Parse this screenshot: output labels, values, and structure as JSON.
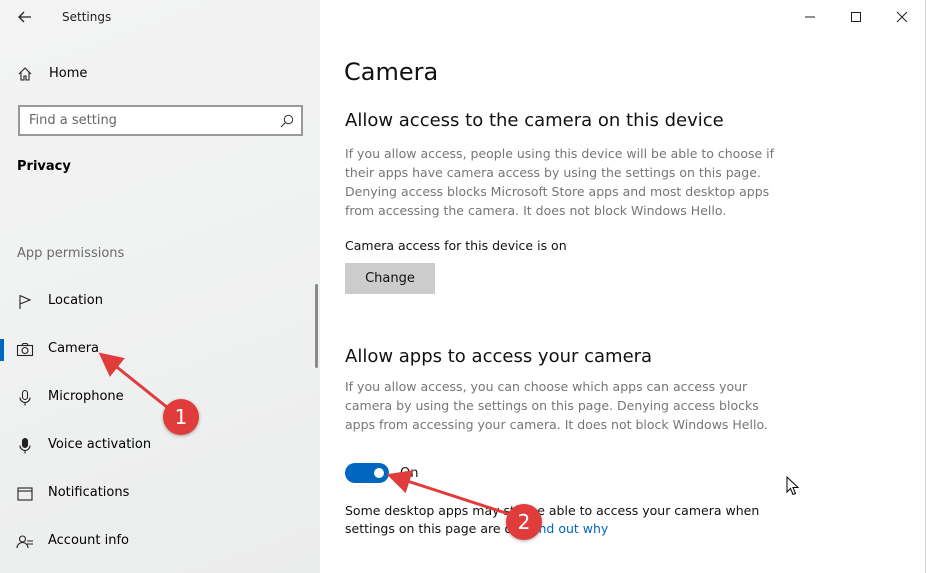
{
  "window": {
    "title": "Settings",
    "controls": {
      "minimize": "minimize-icon",
      "maximize": "maximize-icon",
      "close": "close-icon"
    }
  },
  "sidebar": {
    "home_label": "Home",
    "search_placeholder": "Find a setting",
    "section_title": "Privacy",
    "group_label": "App permissions",
    "items": [
      {
        "label": "Location",
        "icon": "location-icon",
        "selected": false
      },
      {
        "label": "Camera",
        "icon": "camera-icon",
        "selected": true
      },
      {
        "label": "Microphone",
        "icon": "microphone-icon",
        "selected": false
      },
      {
        "label": "Voice activation",
        "icon": "voice-activation-icon",
        "selected": false
      },
      {
        "label": "Notifications",
        "icon": "notifications-icon",
        "selected": false
      },
      {
        "label": "Account info",
        "icon": "account-info-icon",
        "selected": false
      }
    ]
  },
  "main": {
    "title": "Camera",
    "device_section": {
      "heading": "Allow access to the camera on this device",
      "description": "If you allow access, people using this device will be able to choose if their apps have camera access by using the settings on this page. Denying access blocks Microsoft Store apps and most desktop apps from accessing the camera. It does not block Windows Hello.",
      "status": "Camera access for this device is on",
      "button_label": "Change"
    },
    "apps_section": {
      "heading": "Allow apps to access your camera",
      "description": "If you allow access, you can choose which apps can access your camera by using the settings on this page. Denying access blocks apps from accessing your camera. It does not block Windows Hello.",
      "toggle_state": "On",
      "toggle_on": true,
      "note_prefix": "Some desktop apps may still be able to access your camera when settings on this page are off.",
      "note_link": "Find out why"
    }
  },
  "annotations": {
    "badge1": "1",
    "badge2": "2",
    "color": "#e13c3c"
  },
  "colors": {
    "accent": "#0067c0",
    "sidebar_bg": "#f2f2f2",
    "button_bg": "#cccccc",
    "muted_text": "#767676"
  }
}
